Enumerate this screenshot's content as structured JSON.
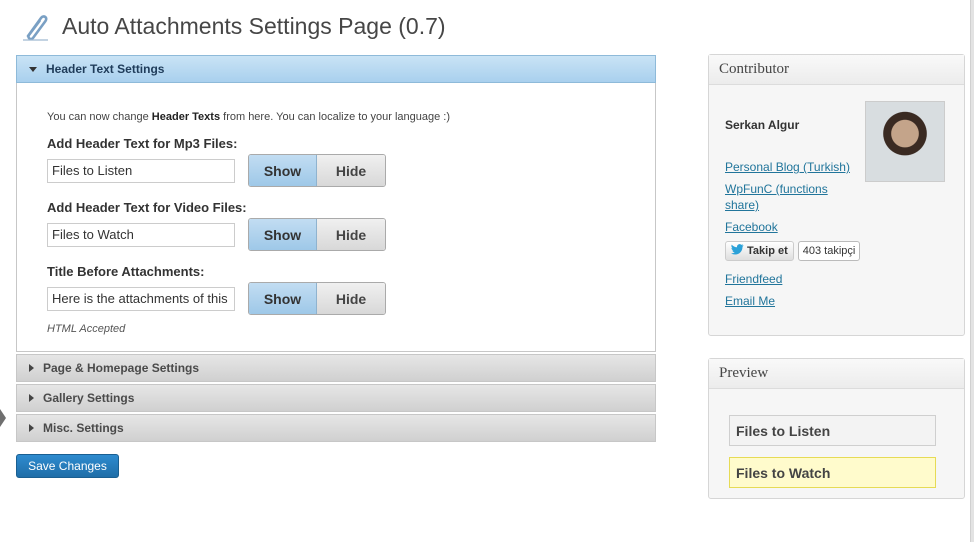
{
  "page": {
    "title": "Auto Attachments Settings Page (0.7)"
  },
  "sections": {
    "header_text": {
      "title": "Header Text Settings",
      "intro_before": "You can now change ",
      "intro_bold": "Header Texts",
      "intro_after": " from here. You can localize to your language :)",
      "fields": [
        {
          "label": "Add Header Text for Mp3 Files:",
          "value": "Files to Listen",
          "show": "Show",
          "hide": "Hide"
        },
        {
          "label": "Add Header Text for Video Files:",
          "value": "Files to Watch",
          "show": "Show",
          "hide": "Hide"
        },
        {
          "label": "Title Before Attachments:",
          "value": "Here is the attachments of this",
          "show": "Show",
          "hide": "Hide"
        }
      ],
      "html_note": "HTML Accepted"
    },
    "collapsed": [
      {
        "title": "Page & Homepage Settings"
      },
      {
        "title": "Gallery Settings"
      },
      {
        "title": "Misc. Settings"
      }
    ]
  },
  "save_button": "Save Changes",
  "contributor": {
    "heading": "Contributor",
    "name": "Serkan Algur",
    "links": [
      "Personal Blog (Turkish)",
      "WpFunC (functions share)",
      "Facebook",
      "Friendfeed",
      "Email Me"
    ],
    "follow_label": "Takip et",
    "follow_count": "403 takipçi"
  },
  "preview": {
    "heading": "Preview",
    "items": [
      "Files to Listen",
      "Files to Watch"
    ]
  },
  "colors": {
    "accent": "#21759b",
    "save_button": "#2e8bcf",
    "active_panel": "#a9d0ee",
    "highlight": "#fffbcc"
  }
}
